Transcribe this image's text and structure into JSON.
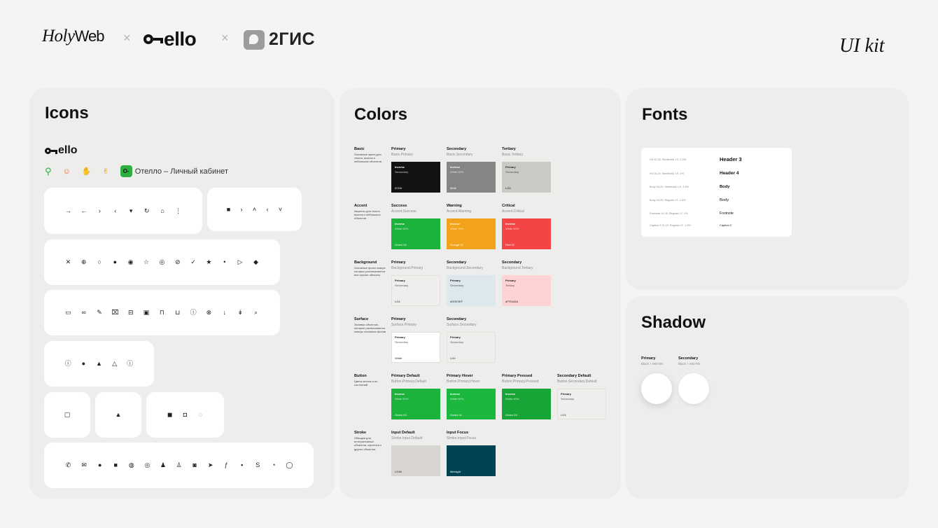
{
  "header": {
    "brand_holy": "Holy",
    "brand_web": "Web",
    "times1": "×",
    "brand_otello": "ello",
    "times2": "×",
    "brand_2gis": "2ГИС",
    "uikit": "UI kit"
  },
  "icons": {
    "title": "Icons",
    "logo_text": "ello",
    "cabinet_label": "Отелло – Личный кабинет",
    "cards": [
      [
        "arrow-right-icon",
        "arrow-left-icon",
        "chevron-right-icon",
        "chevron-left-icon",
        "caret-down-icon",
        "refresh-icon",
        "home-icon",
        "more-vertical-icon"
      ],
      [
        "square-dot-icon",
        "chevron-small-right-icon",
        "chevron-small-up-icon",
        "chevron-small-left-icon",
        "chevron-small-down-icon"
      ],
      [
        "close-icon",
        "plus-circle-icon",
        "circle-icon",
        "check-circle-filled-icon",
        "radio-on-icon",
        "star-outline-icon",
        "eye-icon",
        "eye-off-icon",
        "check-icon",
        "star-filled-icon",
        "dot-icon",
        "play-icon",
        "tag-filled-icon"
      ],
      [
        "file-icon",
        "link-icon",
        "edit-icon",
        "trash-icon",
        "archive-icon",
        "box-icon",
        "lock-icon",
        "unlock-icon",
        "info-circle-icon",
        "pin-off-icon",
        "pin-icon",
        "pin-alt-icon",
        "search-icon"
      ],
      [
        "info-icon",
        "info-filled-icon",
        "bell-filled-icon",
        "bell-icon",
        "alert-icon"
      ],
      [
        "calendar-icon"
      ],
      [
        "image-icon"
      ],
      [
        "bag-icon",
        "lock-filled-icon",
        "location-icon"
      ],
      [
        "phone-icon",
        "mail-icon",
        "user-circle-icon",
        "chat-icon",
        "globe-filled-icon",
        "globe-icon",
        "users-icon",
        "users-alt-icon",
        "instagram-icon",
        "telegram-icon",
        "facebook-icon",
        "vk-icon",
        "skype-icon",
        "viber-icon",
        "whatsapp-icon"
      ]
    ],
    "glyphs": {
      "arrow-right-icon": "→",
      "arrow-left-icon": "←",
      "chevron-right-icon": "›",
      "chevron-left-icon": "‹",
      "caret-down-icon": "▾",
      "refresh-icon": "↻",
      "home-icon": "⌂",
      "more-vertical-icon": "⋮",
      "square-dot-icon": "■",
      "chevron-small-right-icon": "›",
      "chevron-small-up-icon": "˄",
      "chevron-small-left-icon": "‹",
      "chevron-small-down-icon": "˅",
      "close-icon": "✕",
      "plus-circle-icon": "⊕",
      "circle-icon": "○",
      "check-circle-filled-icon": "●",
      "radio-on-icon": "◉",
      "star-outline-icon": "☆",
      "eye-icon": "◎",
      "eye-off-icon": "⊘",
      "check-icon": "✓",
      "star-filled-icon": "★",
      "dot-icon": "•",
      "play-icon": "▷",
      "tag-filled-icon": "◆",
      "file-icon": "▭",
      "link-icon": "∞",
      "edit-icon": "✎",
      "trash-icon": "⌧",
      "archive-icon": "⊟",
      "box-icon": "▣",
      "lock-icon": "⊓",
      "unlock-icon": "⊔",
      "info-circle-icon": "ⓘ",
      "pin-off-icon": "⊗",
      "pin-icon": "↓",
      "pin-alt-icon": "↡",
      "search-icon": "⌕",
      "info-icon": "ⓘ",
      "info-filled-icon": "●",
      "bell-filled-icon": "▲",
      "bell-icon": "△",
      "alert-icon": "ⓘ",
      "calendar-icon": "▢",
      "image-icon": "▲",
      "bag-icon": "◼",
      "lock-filled-icon": "◘",
      "location-icon": "◌",
      "phone-icon": "✆",
      "mail-icon": "✉",
      "user-circle-icon": "●",
      "chat-icon": "■",
      "globe-filled-icon": "◍",
      "globe-icon": "◎",
      "users-icon": "♟",
      "users-alt-icon": "♙",
      "instagram-icon": "◙",
      "telegram-icon": "➤",
      "facebook-icon": "ƒ",
      "vk-icon": "▪",
      "skype-icon": "S",
      "viber-icon": "◔",
      "whatsapp-icon": "◯",
      "search-green-icon": "⌕",
      "emoji-smile-icon": "☺",
      "emoji-clap-icon": "✋",
      "emoji-thumb-icon": "👍"
    }
  },
  "colors": {
    "title": "Colors",
    "rows": [
      {
        "category": "Basic",
        "desc": "Основные цвета для текста, иконок и небольших объектов",
        "swatches": [
          {
            "name": "Primary",
            "token": "Basic.Primary",
            "bg": "#121212",
            "fg": "#ffffff",
            "l1": "Inverse",
            "l2": "Secondary",
            "hex": "0C0A"
          },
          {
            "name": "Secondary",
            "token": "Basic.Secondary",
            "bg": "#858583",
            "fg": "#ffffff",
            "l1": "Inverse",
            "l2": "White 60%",
            "hex": "86d6"
          },
          {
            "name": "Tertiary",
            "token": "Basic.Tertiary",
            "bg": "#cbc9c5",
            "fg": "#222222",
            "l1": "Primary",
            "l2": "Secondary",
            "hex": "LG5"
          }
        ]
      },
      {
        "category": "Accent",
        "desc": "Акценты для текста иконок и небольших объектов",
        "swatches": [
          {
            "name": "Success",
            "token": "Accent.Success",
            "bg": "#1bb33b",
            "fg": "#ffffff",
            "l1": "Inverse",
            "l2": "White 60%",
            "hex": "Green 02"
          },
          {
            "name": "Warning",
            "token": "Accent.Warning",
            "bg": "#f3a21c",
            "fg": "#ffffff",
            "l1": "Inverse",
            "l2": "White 70%",
            "hex": "Orange 01"
          },
          {
            "name": "Critical",
            "token": "Accent.Critical",
            "bg": "#f44446",
            "fg": "#ffffff",
            "l1": "Inverse",
            "l2": "White 60%",
            "hex": "Red 02"
          }
        ]
      },
      {
        "category": "Background",
        "desc": "Основные фоны поверх которых располагаются все прочие объекты",
        "swatches": [
          {
            "name": "Primary",
            "token": "Background.Primary",
            "bg": "#efeeec",
            "fg": "#222222",
            "l1": "Primary",
            "l2": "Secondary",
            "hex": "LG4"
          },
          {
            "name": "Secondary",
            "token": "Background.Secondary",
            "bg": "#dde8ec",
            "fg": "#222222",
            "l1": "Primary",
            "l2": "Secondary",
            "hex": "#DDE3EF"
          },
          {
            "name": "Secondary",
            "token": "Background.Tertiary",
            "bg": "#fdd3d3",
            "fg": "#222222",
            "l1": "Primary",
            "l2": "Tertiary",
            "hex": "#FFDADA"
          }
        ]
      },
      {
        "category": "Surface",
        "desc": "Заливки объектов, которые располагаются поверх основных фонов",
        "swatches": [
          {
            "name": "Primary",
            "token": "Surface.Primary",
            "bg": "#ffffff",
            "fg": "#222222",
            "l1": "Primary",
            "l2": "Secondary",
            "hex": "White"
          },
          {
            "name": "Secondary",
            "token": "Surface.Secondary",
            "bg": "#efeeec",
            "fg": "#222222",
            "l1": "Primary",
            "l2": "Secondary",
            "hex": "LG4"
          }
        ]
      },
      {
        "category": "Button",
        "desc": "Цвета кнопок и их состояний",
        "swatches": [
          {
            "name": "Primary Default",
            "token": "Button.Primary.Default",
            "bg": "#1bb33b",
            "fg": "#ffffff",
            "l1": "Inverse",
            "l2": "White 60%",
            "hex": "Green 02"
          },
          {
            "name": "Primary Hover",
            "token": "Button.Primary.Hover",
            "bg": "#1cb83d",
            "fg": "#ffffff",
            "l1": "Inverse",
            "l2": "White 60%",
            "hex": "Green 01"
          },
          {
            "name": "Primary Pressed",
            "token": "Button.Primary.Pressed",
            "bg": "#18a537",
            "fg": "#ffffff",
            "l1": "Inverse",
            "l2": "White 60%",
            "hex": "Green 03"
          },
          {
            "name": "Secondary Default",
            "token": "Button.Secondary.Default",
            "bg": "#efeeec",
            "fg": "#222222",
            "l1": "Primary",
            "l2": "Secondary",
            "hex": "LG4"
          }
        ]
      },
      {
        "category": "Stroke",
        "desc": "Обводки для интерактивных объектов, карточек и других объектов",
        "swatches": [
          {
            "name": "Input Default",
            "token": "Stroke.Input.Default",
            "bg": "#d7d4d1",
            "fg": "#222222",
            "l1": "",
            "l2": "",
            "hex": "LG45"
          },
          {
            "name": "Input Focus",
            "token": "Stroke.Input.Focus",
            "bg": "#004352",
            "fg": "#ffffff",
            "l1": "",
            "l2": "",
            "hex": "Midnight"
          }
        ]
      }
    ]
  },
  "fonts": {
    "title": "Fonts",
    "rows": [
      {
        "spec": "H3 22-28, SemiboldL  LS -1.5%",
        "sample": "Header 3",
        "size": 7.5
      },
      {
        "spec": "H4 18-24, SemiboldL  LS -1%",
        "sample": "Header 4",
        "size": 6.5
      },
      {
        "spec": "Body 16-20, SemiboldL  LS -1.5%",
        "sample": "Body",
        "size": 5.8
      },
      {
        "spec": "Body 16-20, Regular  LS -1.5%",
        "sample": "Body",
        "size": 5.8
      },
      {
        "spec": "Footnote 14-18, Regular  LS -1%",
        "sample": "Footnote",
        "size": 5
      },
      {
        "spec": "Caption 2 11-14, Regular  LS -1.8%",
        "sample": "Caption 2",
        "size": 4
      }
    ]
  },
  "shadow": {
    "title": "Shadow",
    "items": [
      {
        "name": "Primary",
        "token": "Black + MG700"
      },
      {
        "name": "Secondary",
        "token": "Black + MG700"
      }
    ]
  }
}
